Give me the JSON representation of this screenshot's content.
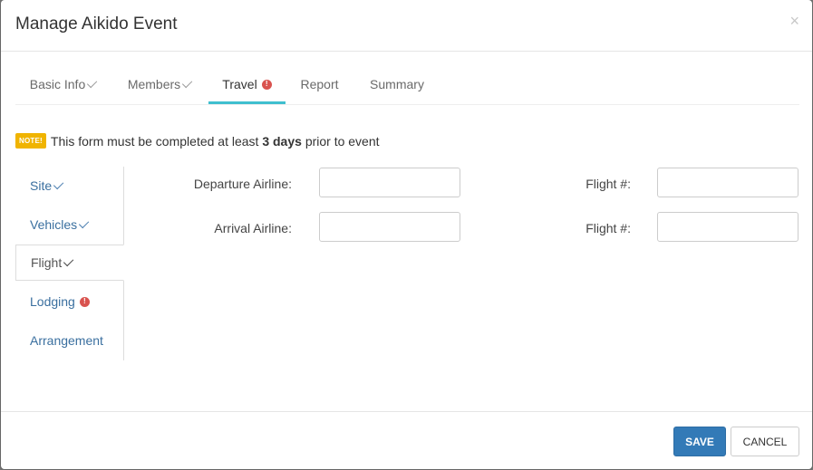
{
  "modal": {
    "title": "Manage Aikido Event",
    "close_label": "×"
  },
  "tabs": [
    {
      "label": "Basic Info",
      "status": "check"
    },
    {
      "label": "Members",
      "status": "check"
    },
    {
      "label": "Travel",
      "status": "warning",
      "active": true
    },
    {
      "label": "Report",
      "status": ""
    },
    {
      "label": "Summary",
      "status": ""
    }
  ],
  "note": {
    "badge": "NOTE!",
    "text_before": "This form must be completed at least",
    "text_bold": "3 days",
    "text_after": "prior to event"
  },
  "subtabs": [
    {
      "label": "Site",
      "status": "check"
    },
    {
      "label": "Vehicles",
      "status": "check"
    },
    {
      "label": "Flight",
      "status": "check",
      "active": true
    },
    {
      "label": "Lodging",
      "status": "warning"
    },
    {
      "label": "Arrangement",
      "status": ""
    }
  ],
  "form": {
    "departure_airline_label": "Departure Airline:",
    "departure_airline_value": "",
    "departure_flight_label": "Flight #:",
    "departure_flight_value": "",
    "arrival_airline_label": "Arrival Airline:",
    "arrival_airline_value": "",
    "arrival_flight_label": "Flight #:",
    "arrival_flight_value": ""
  },
  "footer": {
    "save_label": "SAVE",
    "cancel_label": "CANCEL"
  },
  "colors": {
    "primary": "#337ab7",
    "active_tab_underline": "#3fbfcf",
    "warning": "#d9534f",
    "note_badge": "#f0b400",
    "link": "#3a6f9f"
  }
}
